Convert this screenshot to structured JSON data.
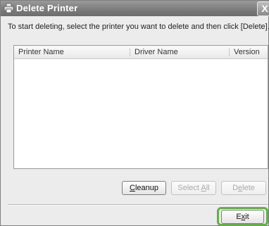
{
  "window": {
    "title": "Delete Printer",
    "close_symbol": "X",
    "title_icon": "printer-icon"
  },
  "instruction": "To start deleting, select the printer you want to delete and then click [Delete].",
  "list": {
    "columns": [
      "Printer Name",
      "Driver Name",
      "Version"
    ],
    "rows": []
  },
  "buttons": {
    "cleanup": {
      "label": "Cleanup",
      "mnemonic": "C",
      "rest": "leanup",
      "enabled": true
    },
    "select_all": {
      "prefix": "Select ",
      "mnemonic": "A",
      "rest": "ll",
      "enabled": false
    },
    "delete": {
      "prefix": "D",
      "mnemonic": "e",
      "rest": "lete",
      "enabled": false
    },
    "exit": {
      "prefix": "E",
      "mnemonic": "x",
      "rest": "it",
      "enabled": true
    }
  },
  "highlight_color": "#5fb33f"
}
